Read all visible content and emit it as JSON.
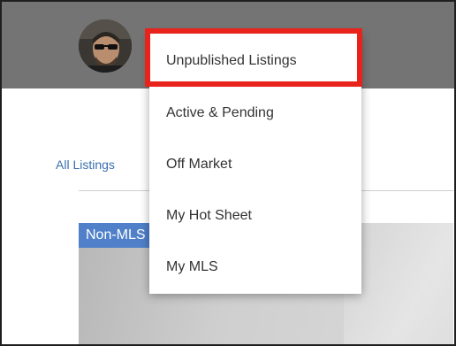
{
  "nav": {
    "all_listings_tab": "All Listings"
  },
  "listing_card": {
    "badge": "Non-MLS"
  },
  "menu": {
    "items": [
      {
        "label": "Unpublished Listings"
      },
      {
        "label": "Active & Pending"
      },
      {
        "label": "Off Market"
      },
      {
        "label": "My Hot Sheet"
      },
      {
        "label": "My MLS"
      }
    ],
    "highlighted_index": 0
  },
  "colors": {
    "header": "#747474",
    "link": "#3a6fb0",
    "badge": "#4f80c9",
    "highlight_border": "#e8231b"
  }
}
